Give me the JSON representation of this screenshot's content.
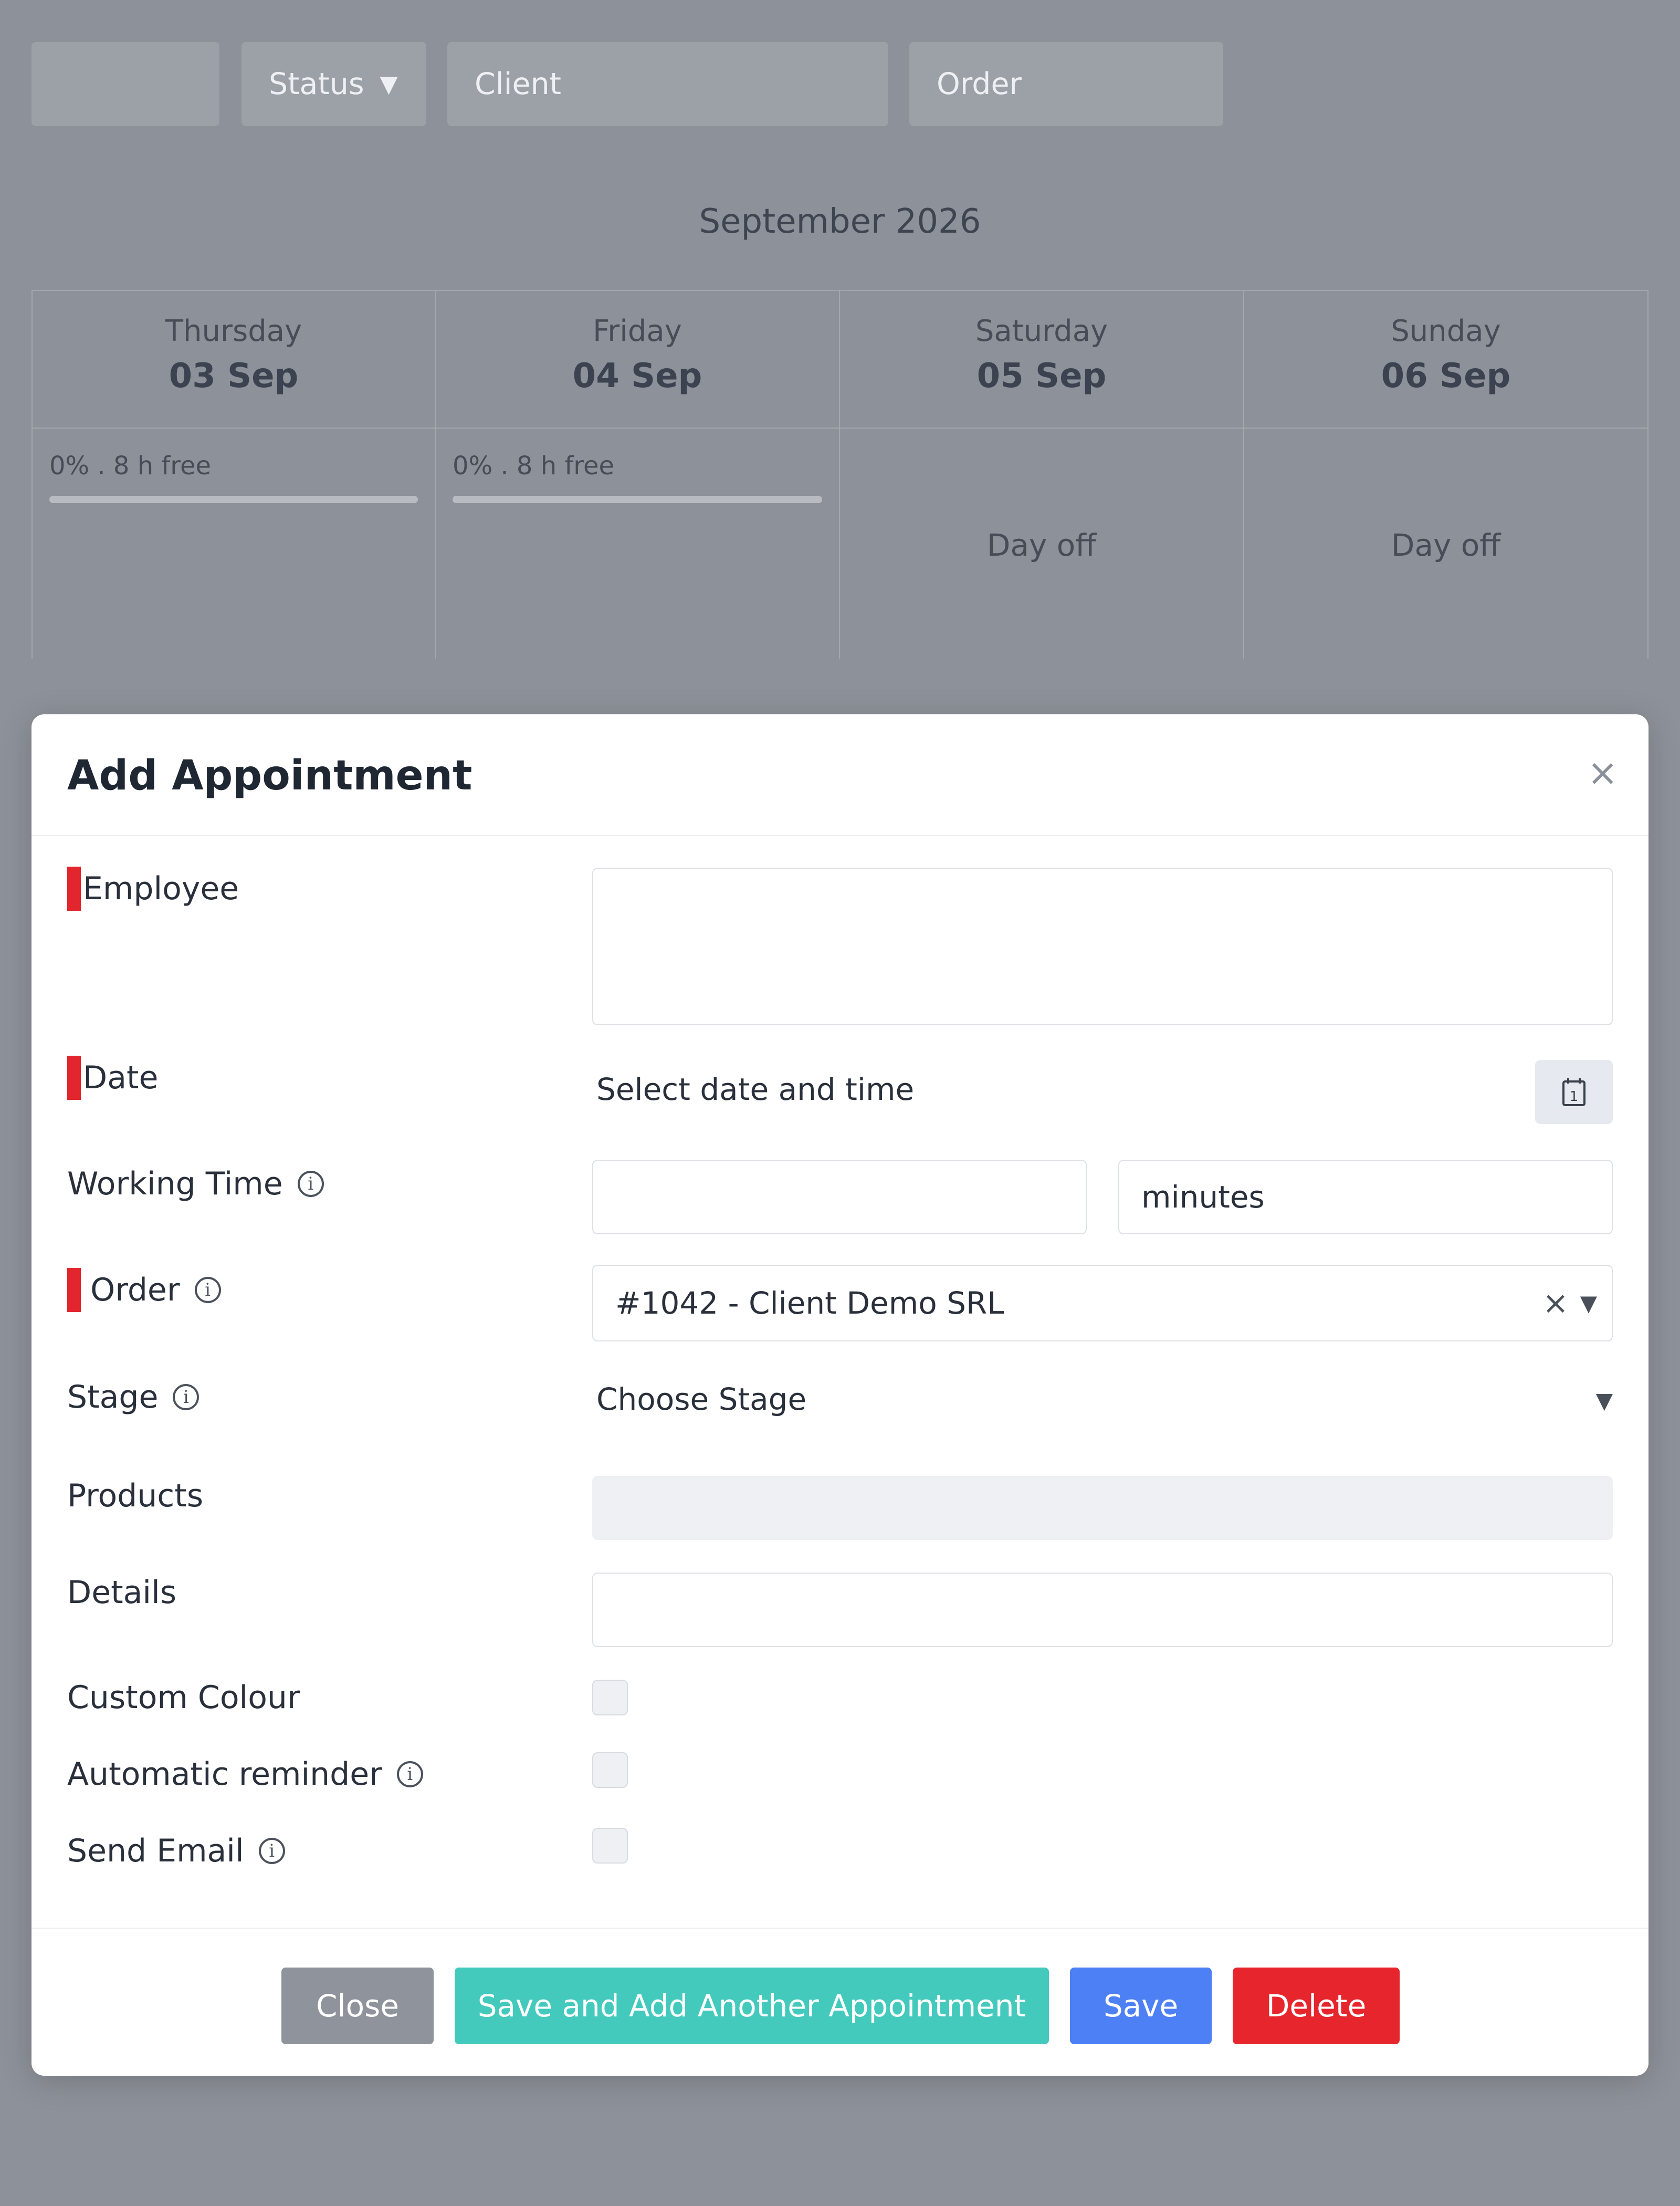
{
  "filters": {
    "first": "",
    "status": "Status",
    "client_placeholder": "Client",
    "order_placeholder": "Order"
  },
  "calendar": {
    "month": "September 2026",
    "days": [
      {
        "name": "Thursday",
        "date": "03 Sep",
        "load": "0% . 8 h free",
        "load_percent": 0,
        "day_off": ""
      },
      {
        "name": "Friday",
        "date": "04 Sep",
        "load": "0% . 8 h free",
        "load_percent": 0,
        "day_off": ""
      },
      {
        "name": "Saturday",
        "date": "05 Sep",
        "load": "",
        "load_percent": null,
        "day_off": "Day off"
      },
      {
        "name": "Sunday",
        "date": "06 Sep",
        "load": "",
        "load_percent": null,
        "day_off": "Day off"
      }
    ]
  },
  "modal": {
    "title": "Add Appointment",
    "close_glyph": "×",
    "fields": {
      "employee_label": "Employee",
      "employee_value": "",
      "date_label": "Date",
      "date_value": "Select date and time",
      "working_time_label": "Working Time",
      "working_time_value": "",
      "working_time_unit": "minutes",
      "order_label": "Order",
      "order_value": "#1042 - Client Demo SRL",
      "stage_label": "Stage",
      "stage_value": "Choose Stage",
      "products_label": "Products",
      "details_label": "Details",
      "details_value": "",
      "custom_colour_label": "Custom Colour",
      "custom_colour_checked": false,
      "auto_reminder_label": "Automatic reminder",
      "auto_reminder_checked": false,
      "send_email_label": "Send Email",
      "send_email_checked": false
    },
    "buttons": {
      "close": "Close",
      "save_add": "Save and Add Another Appointment",
      "save": "Save",
      "delete": "Delete"
    }
  },
  "colors": {
    "overlay": "#8d9199",
    "required": "#e3262e",
    "close_btn": "#8f949c",
    "save_add_btn": "#44c9bd",
    "save_btn": "#4d80f5",
    "delete_btn": "#e7252d"
  },
  "icons": {
    "info": "info-circle-icon",
    "calendar": "calendar-icon",
    "clear": "clear-icon",
    "dropdown": "chevron-down-icon",
    "close": "close-icon"
  }
}
